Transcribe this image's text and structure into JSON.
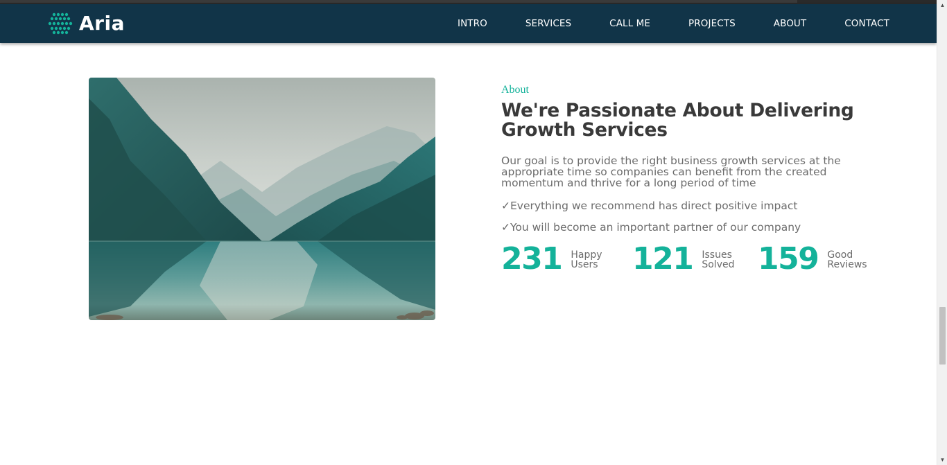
{
  "navbar": {
    "brand": "Aria",
    "items": [
      {
        "label": "INTRO"
      },
      {
        "label": "SERVICES"
      },
      {
        "label": "CALL ME"
      },
      {
        "label": "PROJECTS"
      },
      {
        "label": "ABOUT"
      },
      {
        "label": "CONTACT"
      }
    ]
  },
  "about": {
    "label": "About",
    "headline": "We're Passionate About Delivering Growth Services",
    "lead": "Our goal is to provide the right business growth services at the appropriate time so companies can benefit from the created momentum and thrive for a long period of time",
    "points": [
      "✓Everything we recommend has direct positive impact",
      "✓You will become an important partner of our company"
    ],
    "stats": [
      {
        "number": "231",
        "label": "Happy Users"
      },
      {
        "number": "121",
        "label": "Issues Solved"
      },
      {
        "number": "159",
        "label": "Good Reviews"
      }
    ]
  },
  "colors": {
    "navbar_bg": "#113448",
    "accent": "#14b29a",
    "heading": "#393939",
    "body_text": "#6b6b6b"
  },
  "icons": {
    "logo": "dot-grid-logo-icon",
    "image": "mountain-lake-photo"
  }
}
